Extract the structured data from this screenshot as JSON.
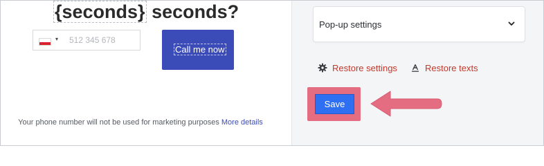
{
  "preview": {
    "headline_token": "{seconds}",
    "headline_rest": " seconds?",
    "phone_placeholder": "512 345 678",
    "flag_caret": "▾",
    "call_button_label": "Call me now",
    "disclaimer_text": "Your phone number will not be used for marketing purposes ",
    "disclaimer_link": "More details"
  },
  "settings": {
    "popup_select_label": "Pop-up settings",
    "restore_settings_label": "Restore settings",
    "restore_texts_label": "Restore texts",
    "save_label": "Save"
  },
  "colors": {
    "call_button": "#3b4bb7",
    "save_button": "#2f6ff2",
    "highlight": "#e46d82",
    "restore_link": "#c0392b"
  },
  "icons": {
    "chevron": "chevron-down-icon",
    "gear": "gear-icon",
    "text_reset": "text-icon",
    "flag": "poland-flag-icon",
    "arrow": "pointer-arrow-icon"
  }
}
